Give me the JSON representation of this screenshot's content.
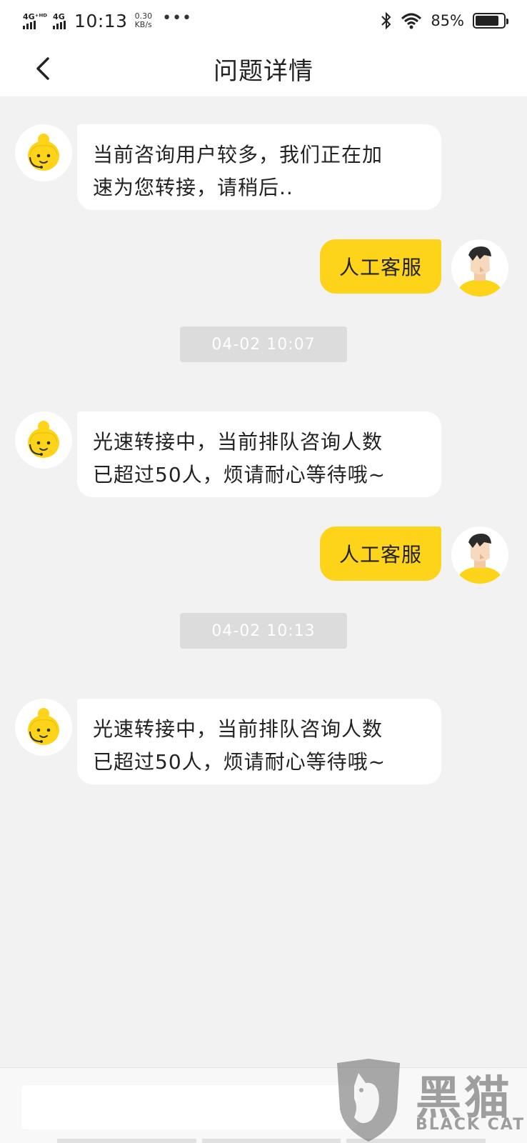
{
  "status_bar": {
    "net1_label": "4G⁺ᴴᴰ",
    "net2_label": "4G",
    "time": "10:13",
    "speed_value": "0.30",
    "speed_unit": "KB/s",
    "more": "•••",
    "battery_percent": "85%",
    "battery_level": 0.85
  },
  "nav": {
    "title": "问题详情"
  },
  "messages": [
    {
      "side": "left",
      "text_line1": "当前咨询用户较多，我们正在加",
      "text_line2": "速为您转接，请稍后.."
    },
    {
      "side": "right",
      "text": "人工客服"
    },
    {
      "side": "timestamp",
      "text": "04-02 10:07"
    },
    {
      "side": "left",
      "text_line1": "光速转接中，当前排队咨询人数",
      "text_line2": "已超过50人，烦请耐心等待哦~"
    },
    {
      "side": "right",
      "text": "人工客服"
    },
    {
      "side": "timestamp",
      "text": "04-02 10:13"
    },
    {
      "side": "left",
      "text_line1": "光速转接中，当前排队咨询人数",
      "text_line2": "已超过50人，烦请耐心等待哦~"
    }
  ],
  "input": {
    "value": ""
  },
  "watermark": {
    "text": "黑猫",
    "sub": "BLACK CAT"
  },
  "colors": {
    "accent": "#fdd41a",
    "background": "#f3f2f3",
    "bubble_left": "#ffffff",
    "timestamp_bg": "#dcdcdc"
  },
  "icons": {
    "back": "chevron-left-icon",
    "agent_avatar": "customer-service-avatar-icon",
    "user_avatar": "user-avatar-icon",
    "bluetooth": "bluetooth-icon",
    "wifi": "wifi-icon",
    "battery": "battery-icon"
  }
}
